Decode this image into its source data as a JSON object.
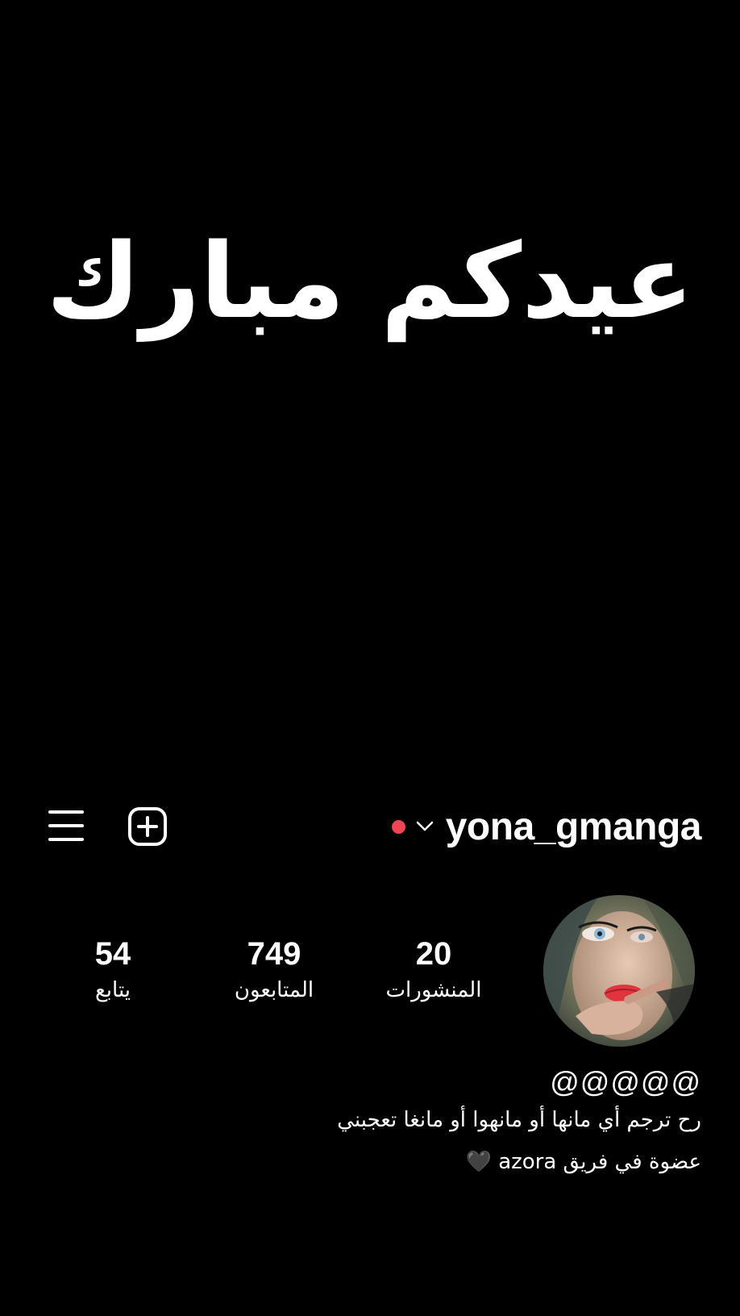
{
  "post_image": {
    "greeting_text": "عيدكم مبارك"
  },
  "header": {
    "username": "yona_gmanga",
    "menu_icon": "hamburger-menu-icon",
    "new_post_icon": "plus-square-icon",
    "dropdown_icon": "chevron-down-icon",
    "status_dot_color": "#ef4456"
  },
  "profile": {
    "avatar_icon": "profile-avatar",
    "stats": {
      "posts": {
        "value": "20",
        "label": "المنشورات"
      },
      "followers": {
        "value": "749",
        "label": "المتابعون"
      },
      "following": {
        "value": "54",
        "label": "يتابع"
      }
    },
    "bio": {
      "name": "@@@@@",
      "line1": "رح ترجم أي مانها أو مانهوا أو مانغا تعجبني",
      "line2": "عضوة في فريق azora 🖤"
    }
  },
  "colors": {
    "background": "#000000",
    "text": "#ffffff",
    "accent_red": "#ef4456"
  }
}
